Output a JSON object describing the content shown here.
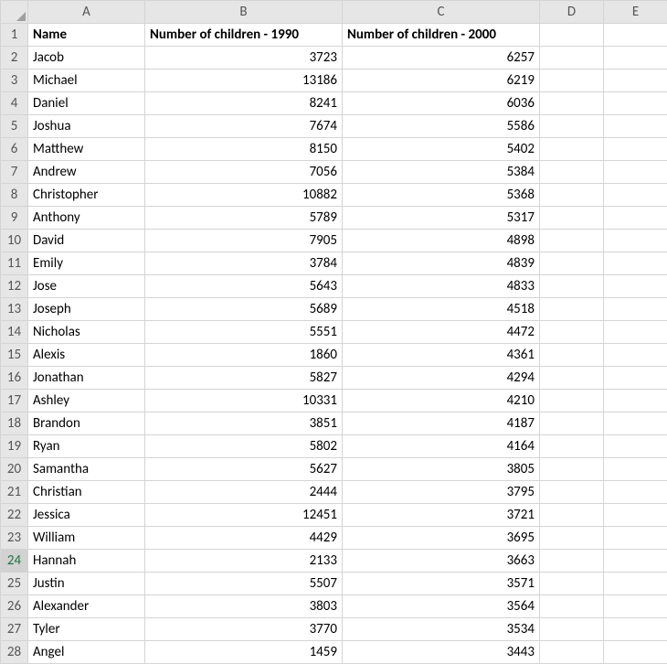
{
  "columns": [
    "A",
    "B",
    "C",
    "D",
    "E"
  ],
  "header_row": [
    "Name",
    "Number of children - 1990",
    "Number of children - 2000",
    "",
    ""
  ],
  "active_row_index": 24,
  "rows": [
    {
      "n": 2,
      "name": "Jacob",
      "y1990": 3723,
      "y2000": 6257
    },
    {
      "n": 3,
      "name": "Michael",
      "y1990": 13186,
      "y2000": 6219
    },
    {
      "n": 4,
      "name": "Daniel",
      "y1990": 8241,
      "y2000": 6036
    },
    {
      "n": 5,
      "name": "Joshua",
      "y1990": 7674,
      "y2000": 5586
    },
    {
      "n": 6,
      "name": "Matthew",
      "y1990": 8150,
      "y2000": 5402
    },
    {
      "n": 7,
      "name": "Andrew",
      "y1990": 7056,
      "y2000": 5384
    },
    {
      "n": 8,
      "name": "Christopher",
      "y1990": 10882,
      "y2000": 5368
    },
    {
      "n": 9,
      "name": "Anthony",
      "y1990": 5789,
      "y2000": 5317
    },
    {
      "n": 10,
      "name": "David",
      "y1990": 7905,
      "y2000": 4898
    },
    {
      "n": 11,
      "name": "Emily",
      "y1990": 3784,
      "y2000": 4839
    },
    {
      "n": 12,
      "name": "Jose",
      "y1990": 5643,
      "y2000": 4833
    },
    {
      "n": 13,
      "name": "Joseph",
      "y1990": 5689,
      "y2000": 4518
    },
    {
      "n": 14,
      "name": "Nicholas",
      "y1990": 5551,
      "y2000": 4472
    },
    {
      "n": 15,
      "name": "Alexis",
      "y1990": 1860,
      "y2000": 4361
    },
    {
      "n": 16,
      "name": "Jonathan",
      "y1990": 5827,
      "y2000": 4294
    },
    {
      "n": 17,
      "name": "Ashley",
      "y1990": 10331,
      "y2000": 4210
    },
    {
      "n": 18,
      "name": "Brandon",
      "y1990": 3851,
      "y2000": 4187
    },
    {
      "n": 19,
      "name": "Ryan",
      "y1990": 5802,
      "y2000": 4164
    },
    {
      "n": 20,
      "name": "Samantha",
      "y1990": 5627,
      "y2000": 3805
    },
    {
      "n": 21,
      "name": "Christian",
      "y1990": 2444,
      "y2000": 3795
    },
    {
      "n": 22,
      "name": "Jessica",
      "y1990": 12451,
      "y2000": 3721
    },
    {
      "n": 23,
      "name": "William",
      "y1990": 4429,
      "y2000": 3695
    },
    {
      "n": 24,
      "name": "Hannah",
      "y1990": 2133,
      "y2000": 3663
    },
    {
      "n": 25,
      "name": "Justin",
      "y1990": 5507,
      "y2000": 3571
    },
    {
      "n": 26,
      "name": "Alexander",
      "y1990": 3803,
      "y2000": 3564
    },
    {
      "n": 27,
      "name": "Tyler",
      "y1990": 3770,
      "y2000": 3534
    },
    {
      "n": 28,
      "name": "Angel",
      "y1990": 1459,
      "y2000": 3443
    }
  ]
}
